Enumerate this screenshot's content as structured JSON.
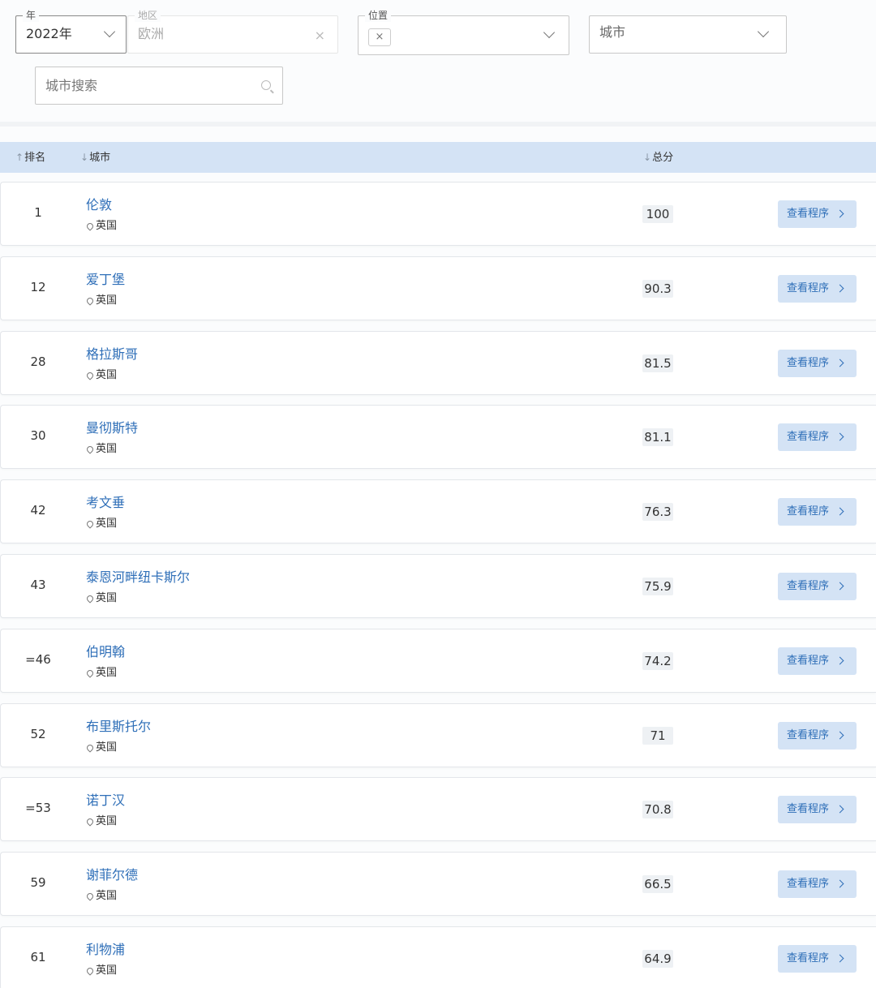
{
  "filters": {
    "year": {
      "legend": "年",
      "value": "2022年"
    },
    "region": {
      "legend": "地区",
      "value": "欧洲"
    },
    "location": {
      "legend": "位置",
      "chip": "×"
    },
    "city": {
      "placeholder": "城市"
    },
    "search": {
      "placeholder": "城市搜索"
    }
  },
  "table": {
    "headers": {
      "rank": "排名",
      "city": "城市",
      "score": "总分"
    },
    "button_label": "查看程序",
    "rows": [
      {
        "rank": "1",
        "city": "伦敦",
        "country": "英国",
        "score": "100"
      },
      {
        "rank": "12",
        "city": "爱丁堡",
        "country": "英国",
        "score": "90.3"
      },
      {
        "rank": "28",
        "city": "格拉斯哥",
        "country": "英国",
        "score": "81.5"
      },
      {
        "rank": "30",
        "city": "曼彻斯特",
        "country": "英国",
        "score": "81.1"
      },
      {
        "rank": "42",
        "city": "考文垂",
        "country": "英国",
        "score": "76.3"
      },
      {
        "rank": "43",
        "city": "泰恩河畔纽卡斯尔",
        "country": "英国",
        "score": "75.9"
      },
      {
        "rank": "=46",
        "city": "伯明翰",
        "country": "英国",
        "score": "74.2"
      },
      {
        "rank": "52",
        "city": "布里斯托尔",
        "country": "英国",
        "score": "71"
      },
      {
        "rank": "=53",
        "city": "诺丁汉",
        "country": "英国",
        "score": "70.8"
      },
      {
        "rank": "59",
        "city": "谢菲尔德",
        "country": "英国",
        "score": "66.5"
      },
      {
        "rank": "61",
        "city": "利物浦",
        "country": "英国",
        "score": "64.9"
      }
    ]
  },
  "colors": {
    "accent": "#2f6fb8",
    "header_bg": "#d4e3f5"
  }
}
